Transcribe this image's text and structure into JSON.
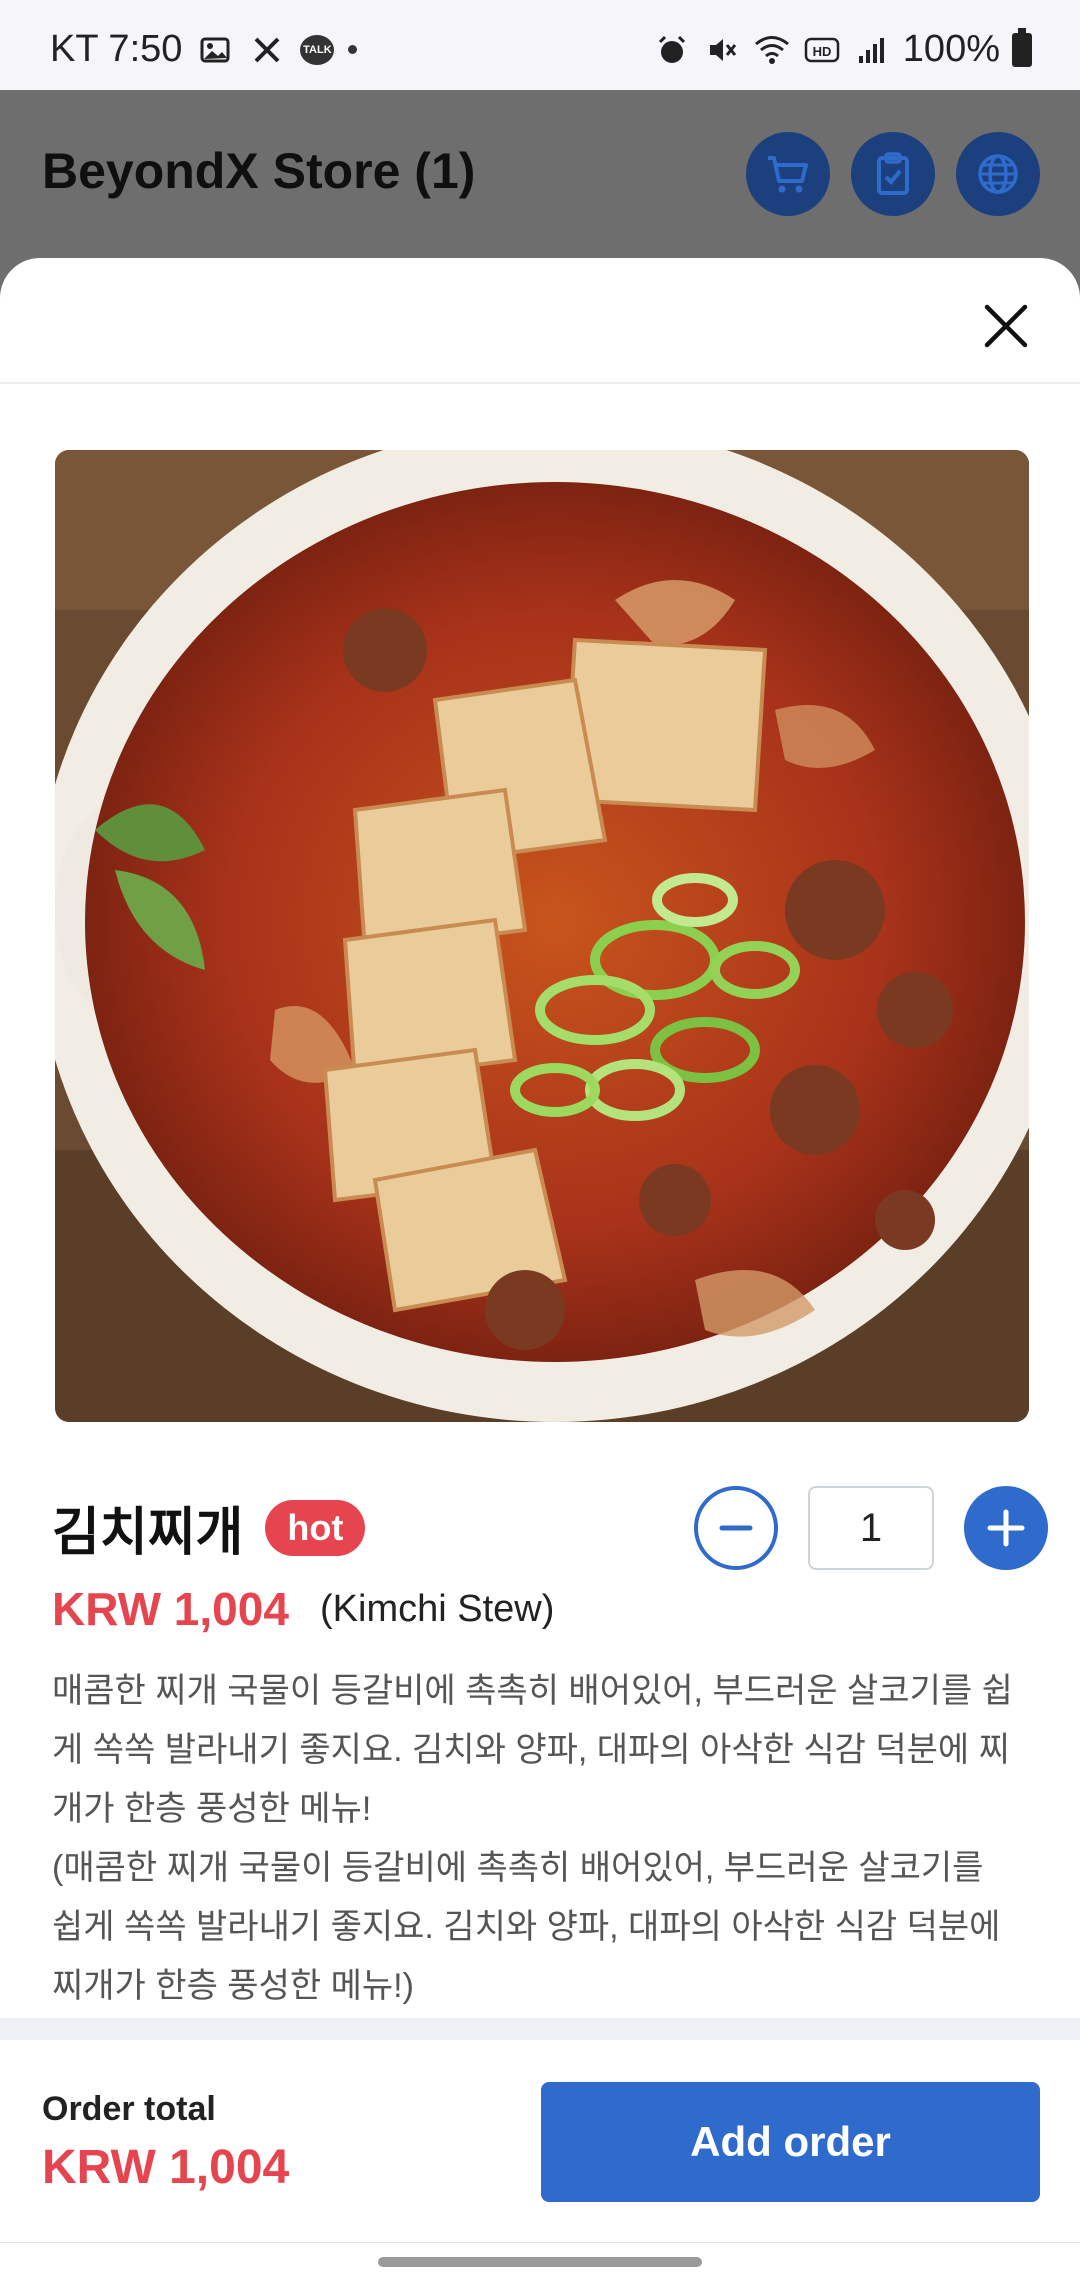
{
  "status_bar": {
    "carrier_time": "KT 7:50",
    "talk_label": "TALK",
    "battery": "100%"
  },
  "header": {
    "title": "BeyondX Store (1)",
    "icons": [
      "cart-icon",
      "clipboard-check-icon",
      "globe-icon"
    ]
  },
  "item": {
    "name": "김치찌개",
    "badge": "hot",
    "quantity": "1",
    "price": "KRW 1,004",
    "english_name": "(Kimchi Stew)",
    "description": "매콤한 찌개 국물이 등갈비에 촉촉히 배어있어, 부드러운 살코기를 쉽\n게 쏙쏙 발라내기 좋지요. 김치와 양파, 대파의 아삭한 식감 덕분에 찌\n개가 한층 풍성한 메뉴!\n(매콤한 찌개 국물이 등갈비에 촉촉히 배어있어, 부드러운 살코기를\n쉽게 쏙쏙 발라내기 좋지요. 김치와 양파, 대파의 아삭한 식감 덕분에\n찌개가 한층 풍성한 메뉴!)"
  },
  "footer": {
    "total_label": "Order total",
    "total_price": "KRW 1,004",
    "add_button": "Add order"
  },
  "colors": {
    "accent_blue": "#2f6bcc",
    "price_red": "#e6454f",
    "header_dim": "#6e6e6e",
    "header_icon_bg": "#1c3f7e"
  }
}
